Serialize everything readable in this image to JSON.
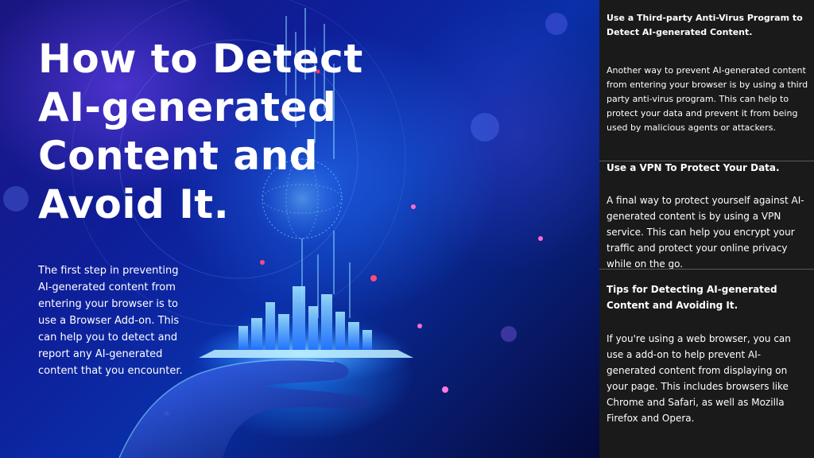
{
  "hero": {
    "title": "How to Detect AI-generated Content and Avoid It.",
    "intro": "The first step in preventing AI-generated content from entering your browser is to use a Browser Add-on. This can help you to detect and report any AI-generated content that you encounter."
  },
  "sidebar": {
    "sections": [
      {
        "heading": "Use a Third-party Anti-Virus Program to Detect AI-generated Content.",
        "body": "Another way to prevent AI-generated content from entering your browser is by using a third party anti-virus program. This can help to protect your data and prevent it from being used by malicious agents or attackers."
      },
      {
        "heading": "Use a VPN To Protect Your Data.",
        "body": "A final way to protect yourself against AI-generated content is by using a VPN service. This can help you encrypt your traffic and protect your online privacy while on the go."
      },
      {
        "heading": "Tips for Detecting AI-generated Content and Avoiding It.",
        "body": "If you're using a web browser, you can use a add-on to help prevent AI-generated content from displaying on your page. This includes browsers like Chrome and Safari, as well as Mozilla Firefox and Opera."
      }
    ]
  },
  "colors": {
    "sidebar_bg": "#1a1a1a",
    "hero_blue": "#0a2fa8",
    "text": "#ffffff"
  },
  "icons": [
    "ai-hand-city-illustration"
  ]
}
